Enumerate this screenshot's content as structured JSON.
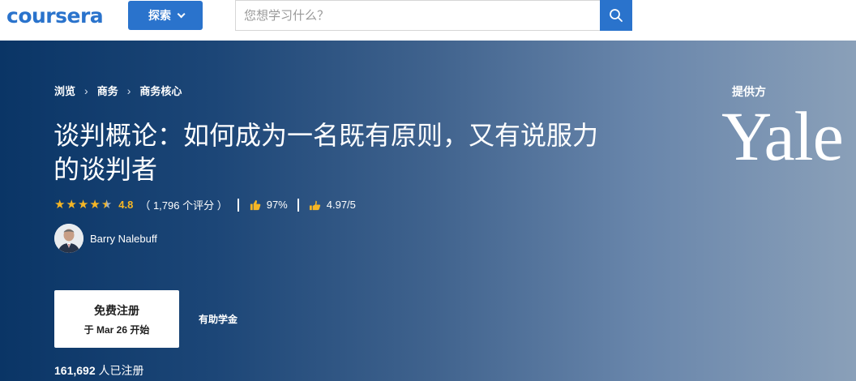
{
  "nav": {
    "logo": "coursera",
    "explore_label": "探索",
    "search_placeholder": "您想学习什么？"
  },
  "breadcrumb": [
    "浏览",
    "商务",
    "商务核心"
  ],
  "course": {
    "title": "谈判概论：如何成为一名既有原则，又有说服力的谈判者",
    "rating": "4.8",
    "rating_count": "（ 1,796 个评分 ）",
    "like_percent": "97%",
    "score": "4.97/5",
    "stars_filled": 4.5,
    "instructor": "Barry Nalebuff"
  },
  "enroll": {
    "main_label": "免费注册",
    "sub_label": "于 Mar 26 开始"
  },
  "financial_aid": "有助学金",
  "enrolled": {
    "count": "161,692",
    "suffix": " 人已注册"
  },
  "provider": {
    "offered_by": "提供方",
    "name": "Yale"
  },
  "colors": {
    "brand_blue": "#2a73cc",
    "star_gold": "#f5b625"
  }
}
